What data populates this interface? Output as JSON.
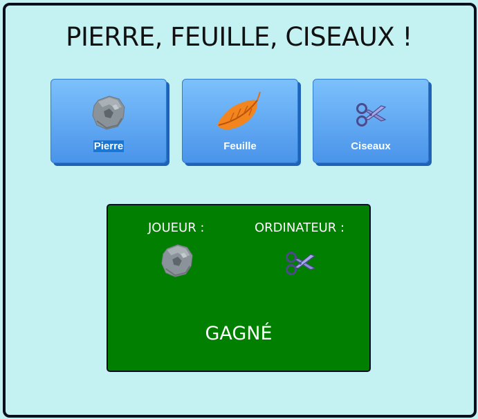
{
  "game": {
    "title": "PIERRE, FEUILLE, CISEAUX !"
  },
  "choices": [
    {
      "label": "Pierre",
      "icon": "rock-icon",
      "selected": true
    },
    {
      "label": "Feuille",
      "icon": "leaf-icon"
    },
    {
      "label": "Ciseaux",
      "icon": "scissors-icon"
    }
  ],
  "result": {
    "player_label": "JOUEUR :",
    "player_choice_icon": "rock-icon",
    "computer_label": "ORDINATEUR :",
    "computer_choice_icon": "scissors-icon",
    "outcome": "GAGNÉ"
  },
  "colors": {
    "background": "#c4f2f2",
    "button": "#5ba4f3",
    "result_panel": "#007f00"
  }
}
